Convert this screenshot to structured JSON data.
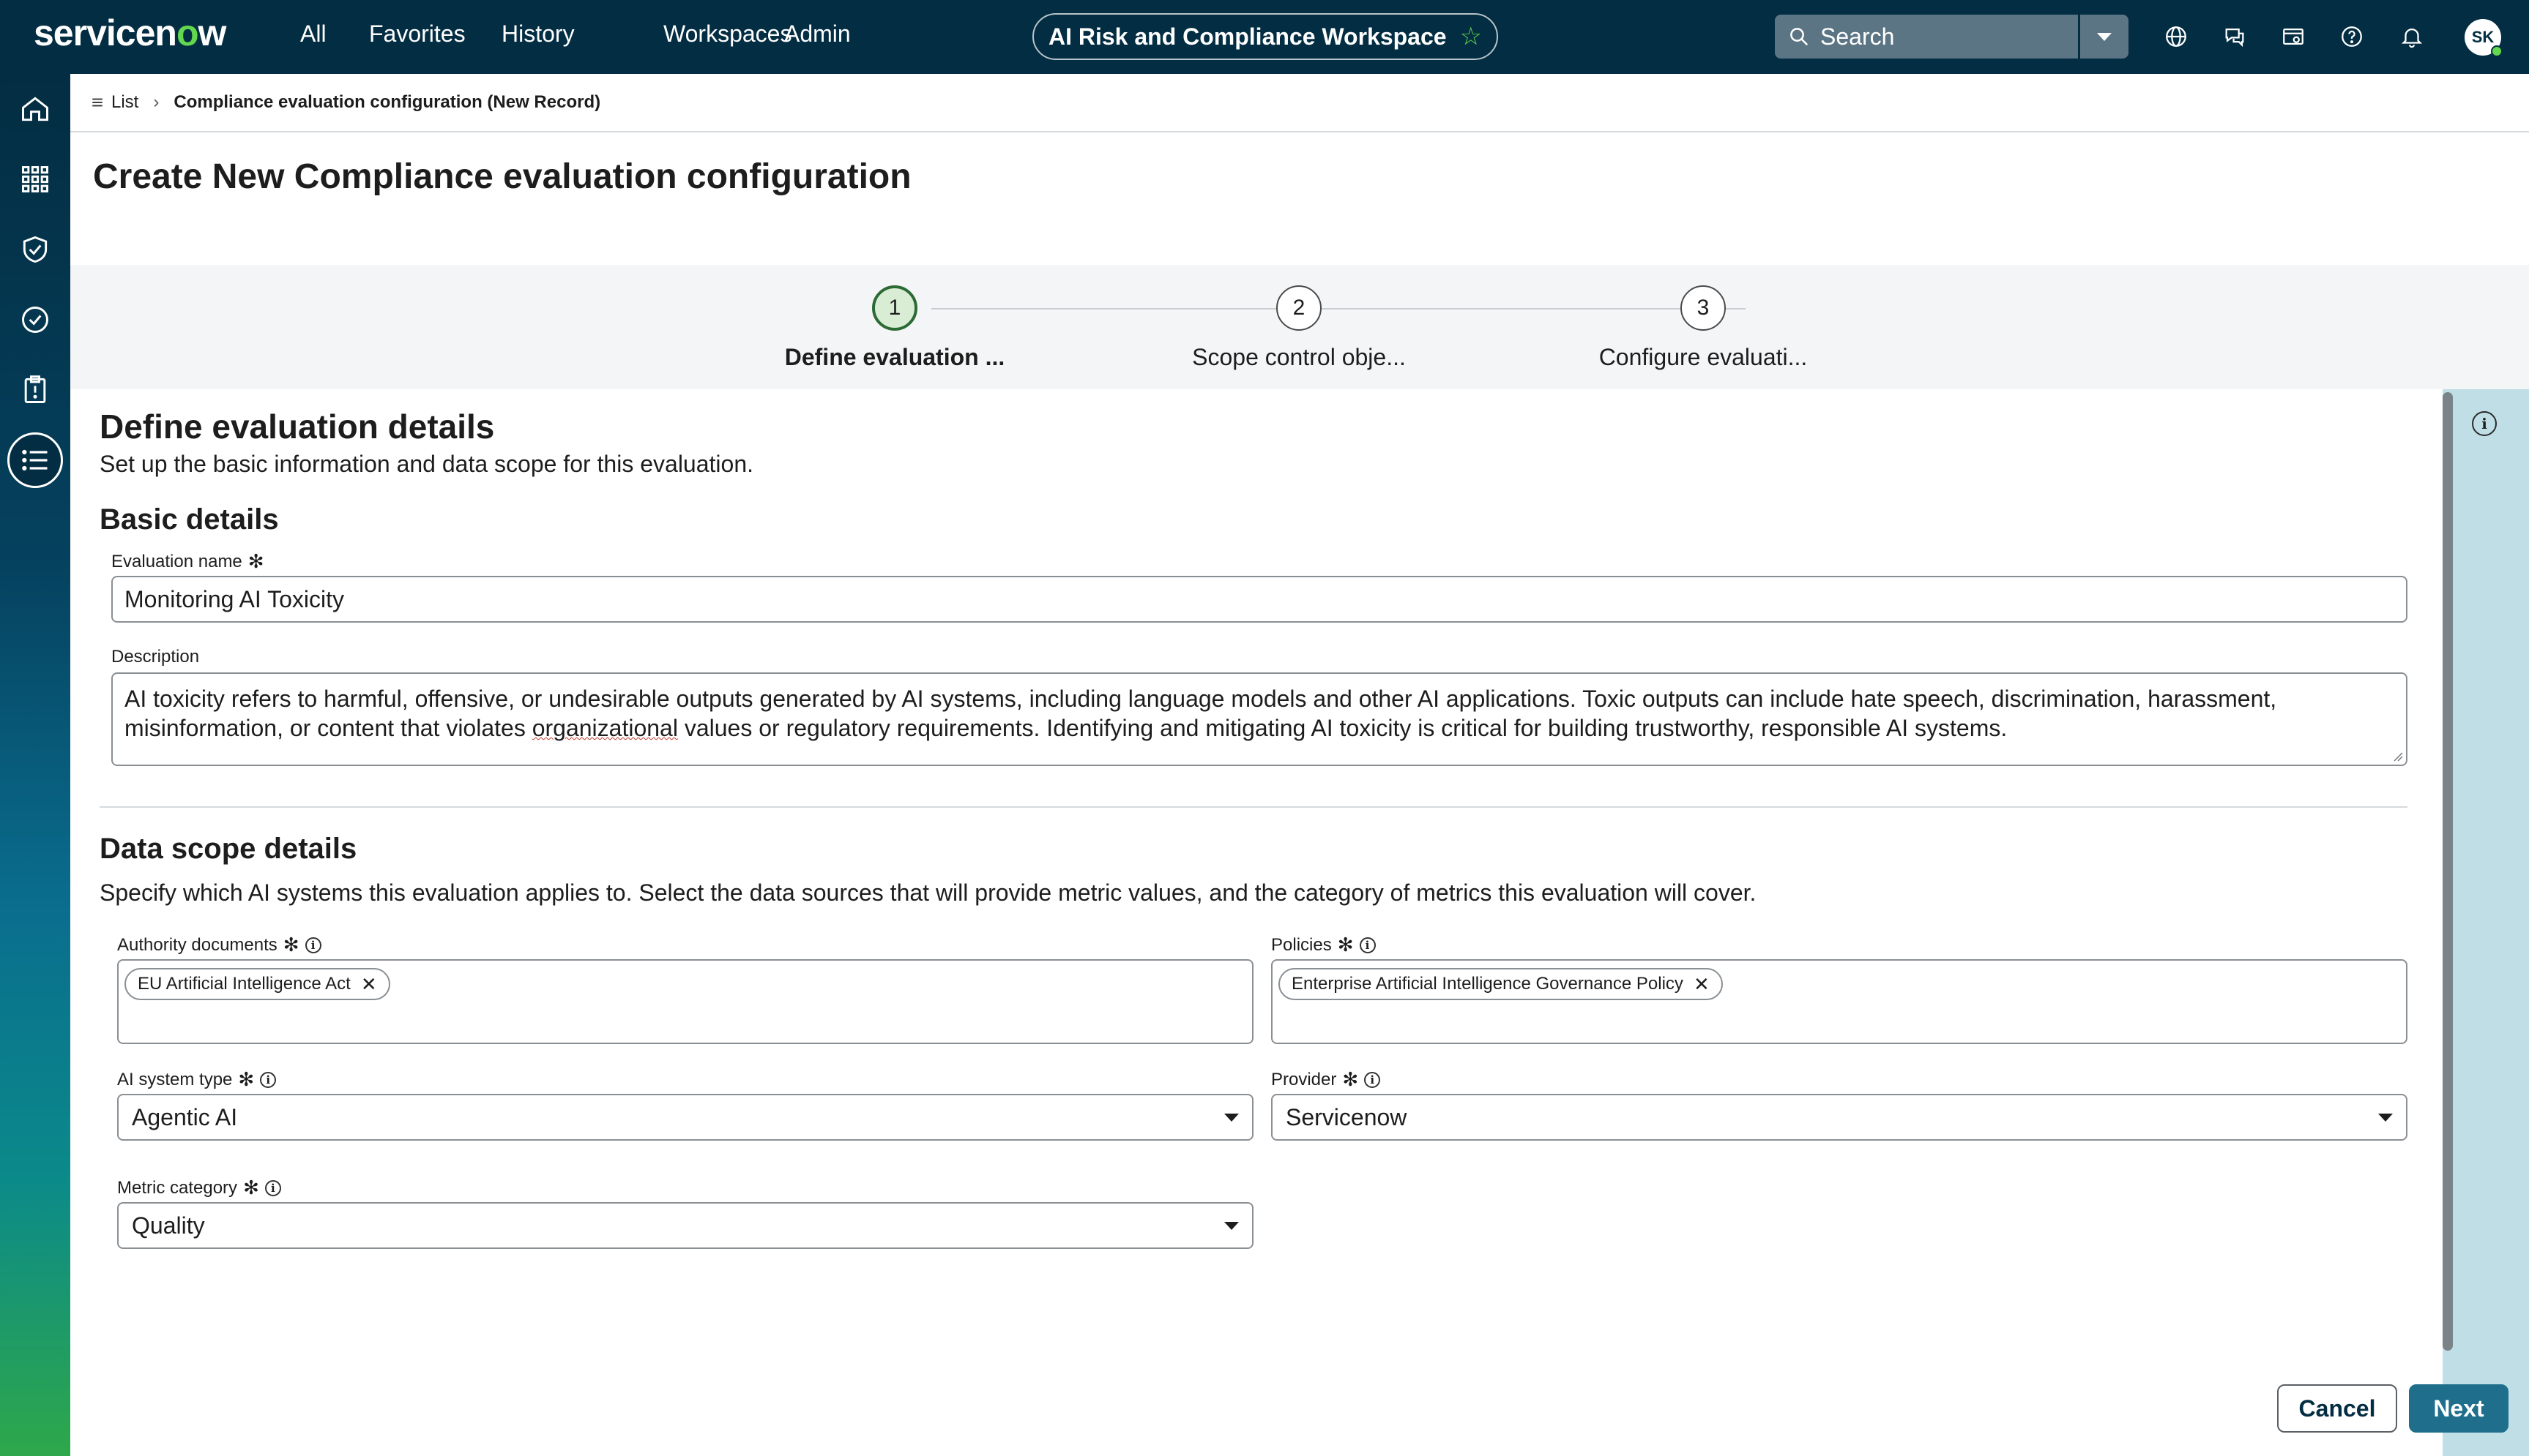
{
  "topbar": {
    "logo": "servicenow",
    "nav": [
      "All",
      "Favorites",
      "History",
      "Workspaces",
      "Admin"
    ],
    "workspace_title": "AI Risk and Compliance Workspace",
    "search_placeholder": "Search",
    "avatar_initials": "SK"
  },
  "breadcrumb": {
    "list_label": "List",
    "current": "Compliance evaluation configuration (New Record)"
  },
  "page_title": "Create New Compliance evaluation configuration",
  "stepper": {
    "steps": [
      {
        "number": "1",
        "label": "Define evaluation ..."
      },
      {
        "number": "2",
        "label": "Scope control obje..."
      },
      {
        "number": "3",
        "label": "Configure evaluati..."
      }
    ]
  },
  "form": {
    "heading": "Define evaluation details",
    "subheading": "Set up the basic information and data scope for this evaluation.",
    "basic_details_title": "Basic details",
    "evaluation_name_label": "Evaluation name",
    "evaluation_name_value": "Monitoring AI Toxicity",
    "description_label": "Description",
    "description_part1": "AI toxicity refers to harmful, offensive, or undesirable outputs generated by AI systems, including language models and other AI applications. Toxic outputs can include hate speech, discrimination, harassment, misinformation, or content that violates ",
    "description_misspelled": "organizational",
    "description_part2": " values or regulatory requirements. Identifying and mitigating AI toxicity is critical for building trustworthy, responsible AI systems.",
    "data_scope_title": "Data scope details",
    "data_scope_desc": "Specify which AI systems this evaluation applies to. Select the data sources that will provide metric values, and the category of metrics this evaluation will cover.",
    "authority_documents_label": "Authority documents",
    "authority_documents": [
      "EU Artificial Intelligence Act"
    ],
    "policies_label": "Policies",
    "policies": [
      "Enterprise Artificial Intelligence Governance Policy"
    ],
    "ai_system_type_label": "AI system type",
    "ai_system_type_value": "Agentic AI",
    "provider_label": "Provider",
    "provider_value": "Servicenow",
    "metric_category_label": "Metric category",
    "metric_category_value": "Quality"
  },
  "footer": {
    "cancel": "Cancel",
    "next": "Next"
  }
}
